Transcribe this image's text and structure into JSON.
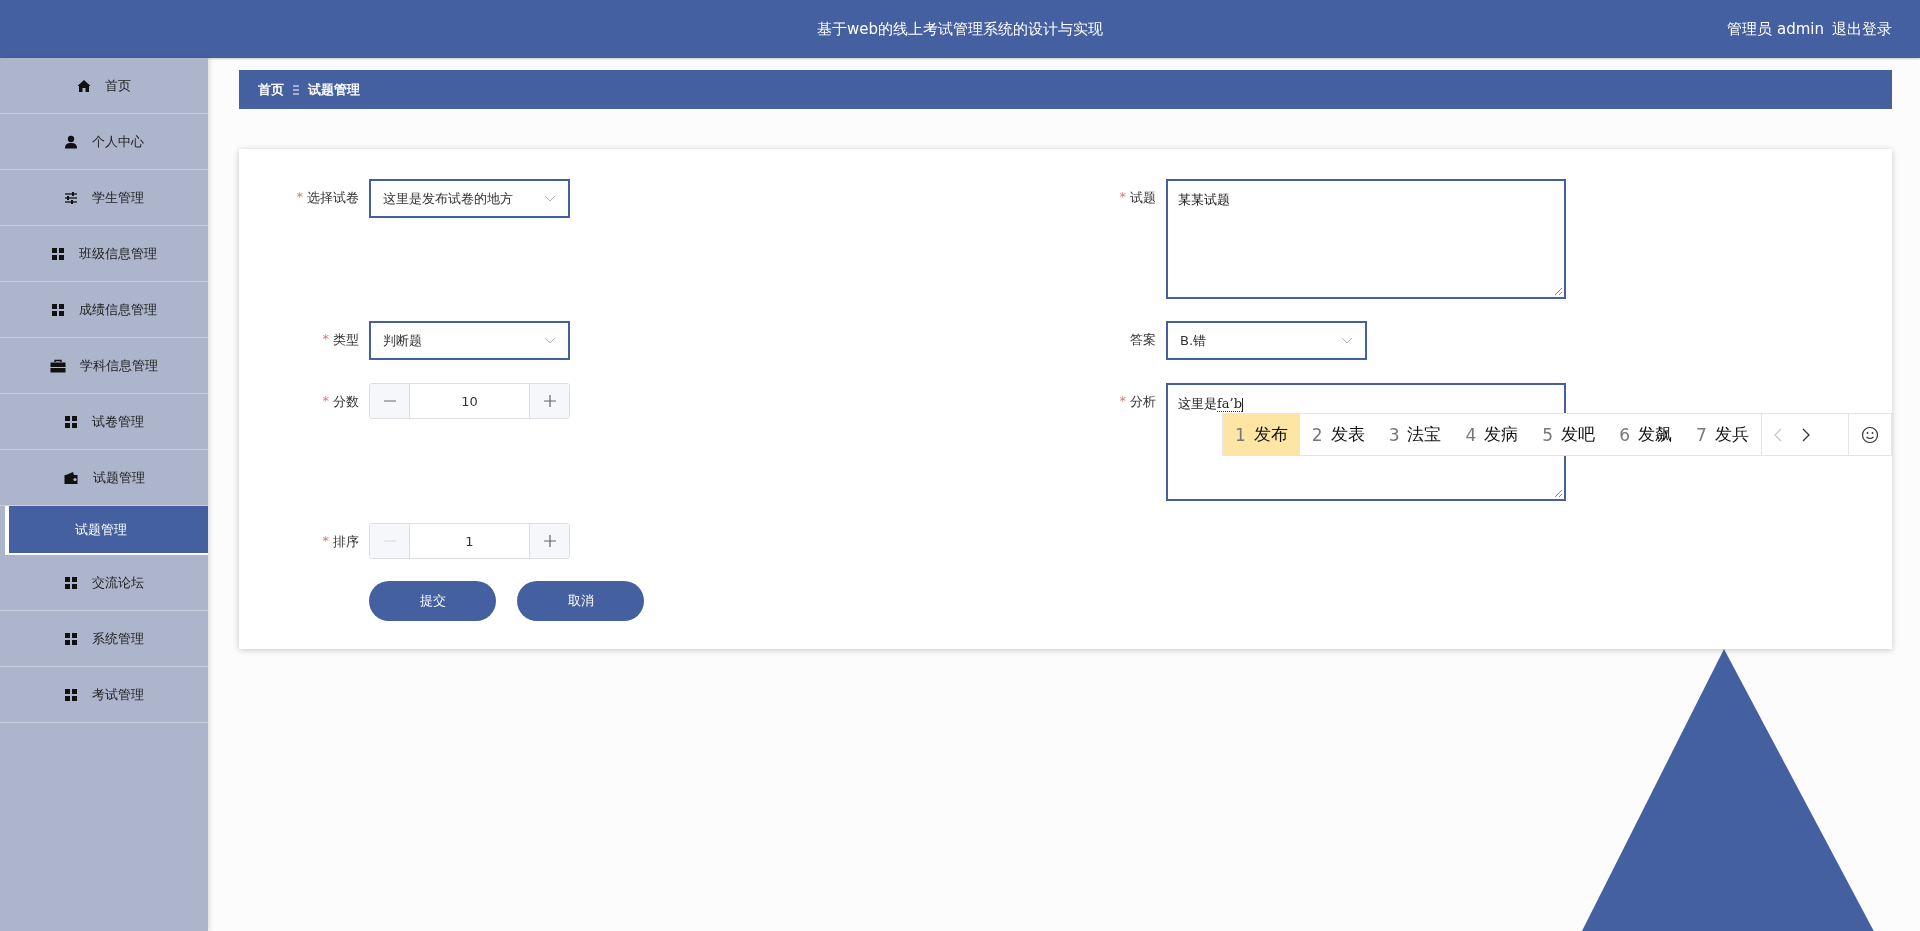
{
  "header": {
    "title": "基于web的线上考试管理系统的设计与实现",
    "user": "管理员 admin",
    "logout": "退出登录"
  },
  "sidebar": {
    "items": [
      {
        "label": "首页",
        "kind": "home",
        "selected": false
      },
      {
        "label": "个人中心",
        "kind": "user",
        "selected": false
      },
      {
        "label": "学生管理",
        "kind": "sliders",
        "selected": false
      },
      {
        "label": "班级信息管理",
        "kind": "grid",
        "selected": false
      },
      {
        "label": "成绩信息管理",
        "kind": "grid",
        "selected": false
      },
      {
        "label": "学科信息管理",
        "kind": "briefcase",
        "selected": false
      },
      {
        "label": "试卷管理",
        "kind": "grid",
        "selected": false
      },
      {
        "label": "试题管理",
        "kind": "wallet",
        "selected": false,
        "children": [
          {
            "label": "试题管理",
            "selected": true
          }
        ]
      },
      {
        "label": "交流论坛",
        "kind": "grid",
        "selected": false
      },
      {
        "label": "系统管理",
        "kind": "grid",
        "selected": false
      },
      {
        "label": "考试管理",
        "kind": "grid",
        "selected": false
      }
    ]
  },
  "breadcrumb": {
    "items": [
      "首页",
      "试题管理"
    ]
  },
  "form": {
    "required_mark": "*",
    "left_column": [
      {
        "label": "选择试卷",
        "required": true,
        "kind": "select",
        "value": "这里是发布试卷的地方"
      },
      {
        "label": "类型",
        "required": true,
        "kind": "select",
        "value": "判断题"
      },
      {
        "label": "分数",
        "required": true,
        "kind": "number",
        "value": "10",
        "minus_disabled": false
      },
      {
        "label": "排序",
        "required": true,
        "kind": "number",
        "value": "1",
        "minus_disabled": true
      }
    ],
    "right_column": [
      {
        "label": "试题",
        "required": true,
        "kind": "textarea",
        "value": "某某试题"
      },
      {
        "label": "答案",
        "required": false,
        "kind": "select",
        "value": "B.错"
      },
      {
        "label": "分析",
        "required": true,
        "kind": "textarea",
        "value": "这里是",
        "composition": "fa’b"
      }
    ],
    "buttons": [
      "提交",
      "取消"
    ]
  },
  "ime": {
    "candidates": [
      {
        "index": "1",
        "text": "发布",
        "selected": true
      },
      {
        "index": "2",
        "text": "发表",
        "selected": false
      },
      {
        "index": "3",
        "text": "法宝",
        "selected": false
      },
      {
        "index": "4",
        "text": "发病",
        "selected": false
      },
      {
        "index": "5",
        "text": "发吧",
        "selected": false
      },
      {
        "index": "6",
        "text": "发飙",
        "selected": false
      },
      {
        "index": "7",
        "text": "发兵",
        "selected": false
      }
    ],
    "prev_disabled": true
  }
}
